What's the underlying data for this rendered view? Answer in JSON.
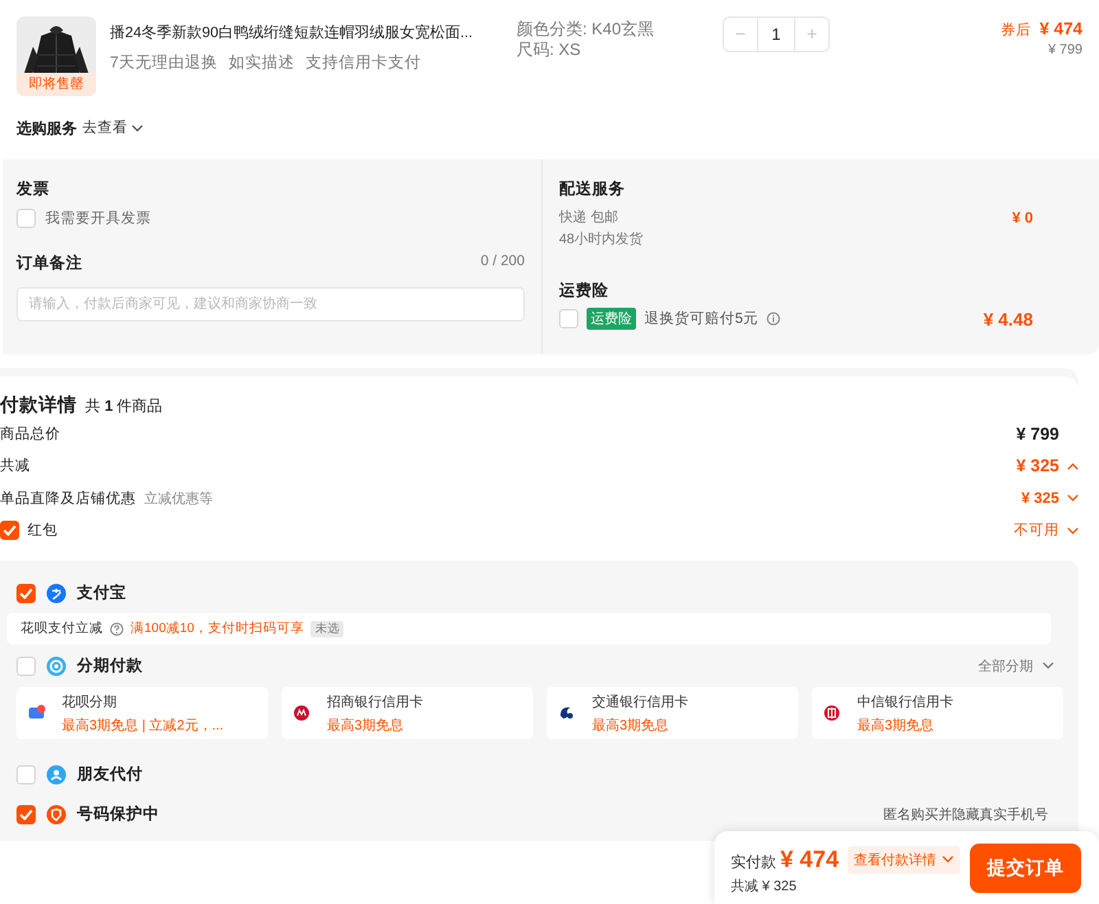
{
  "product": {
    "title": "播24冬季新款90白鸭绒绗缝短款连帽羽绒服女宽松面...",
    "badge": "即将售罄",
    "tags": [
      "7天无理由退换",
      "如实描述",
      "支持信用卡支付"
    ],
    "specs": [
      "颜色分类: K40玄黑",
      "尺码: XS"
    ],
    "quantity": {
      "minus": "−",
      "value": "1",
      "plus": "+"
    },
    "price_label": "券后",
    "price": "¥ 474",
    "original_price": "¥ 799"
  },
  "services": {
    "label": "选购服务",
    "link": "去查看"
  },
  "invoice": {
    "title": "发票",
    "option": "我需要开具发票",
    "checked": false
  },
  "note": {
    "title": "订单备注",
    "counter": "0 / 200",
    "placeholder": "请输入，付款后商家可见，建议和商家协商一致"
  },
  "delivery": {
    "title": "配送服务",
    "method": "快递 包邮",
    "time": "48小时内发货",
    "price": "¥ 0"
  },
  "shipping_insurance": {
    "title": "运费险",
    "checked": false,
    "badge": "运费险",
    "description": "退换货可赔付5元",
    "price": "¥ 4.48"
  },
  "payment_details": {
    "title": "付款详情",
    "count": "共 **1** 件商品",
    "rows": [
      {
        "kind": "total",
        "label": "商品总价",
        "value": "¥ 799"
      },
      {
        "kind": "discount",
        "label": "共减",
        "value": "¥ 325",
        "expanded": true
      },
      {
        "kind": "sub",
        "label": "单品直降及店铺优惠",
        "note": "立减优惠等",
        "value": "¥ 325",
        "expanded": false
      },
      {
        "kind": "check",
        "label": "红包",
        "value": "不可用",
        "checked": true,
        "expanded": false
      }
    ]
  },
  "payment_methods": [
    {
      "kind": "alipay",
      "label": "支付宝",
      "checked": true,
      "promo": {
        "label": "花呗支付立减",
        "text": "满100减10，支付时扫码可享",
        "tag": "未选"
      }
    },
    {
      "kind": "installment",
      "label": "分期付款",
      "checked": false,
      "more": "全部分期",
      "options": [
        {
          "kind": "huabei",
          "name": "花呗分期",
          "offer": "最高3期免息 | 立减2元，..."
        },
        {
          "kind": "cmb",
          "name": "招商银行信用卡",
          "offer": "最高3期免息"
        },
        {
          "kind": "bocom",
          "name": "交通银行信用卡",
          "offer": "最高3期免息"
        },
        {
          "kind": "citic",
          "name": "中信银行信用卡",
          "offer": "最高3期免息"
        }
      ]
    },
    {
      "kind": "friend",
      "label": "朋友代付",
      "checked": false
    },
    {
      "kind": "protect",
      "label": "号码保护中",
      "checked": true,
      "hint": "匿名购买并隐藏真实手机号"
    }
  ],
  "footer": {
    "total_label": "实付款",
    "total": "¥ 474",
    "details_link": "查看付款详情",
    "discount": "共减 ¥ 325",
    "submit": "提交订单"
  }
}
